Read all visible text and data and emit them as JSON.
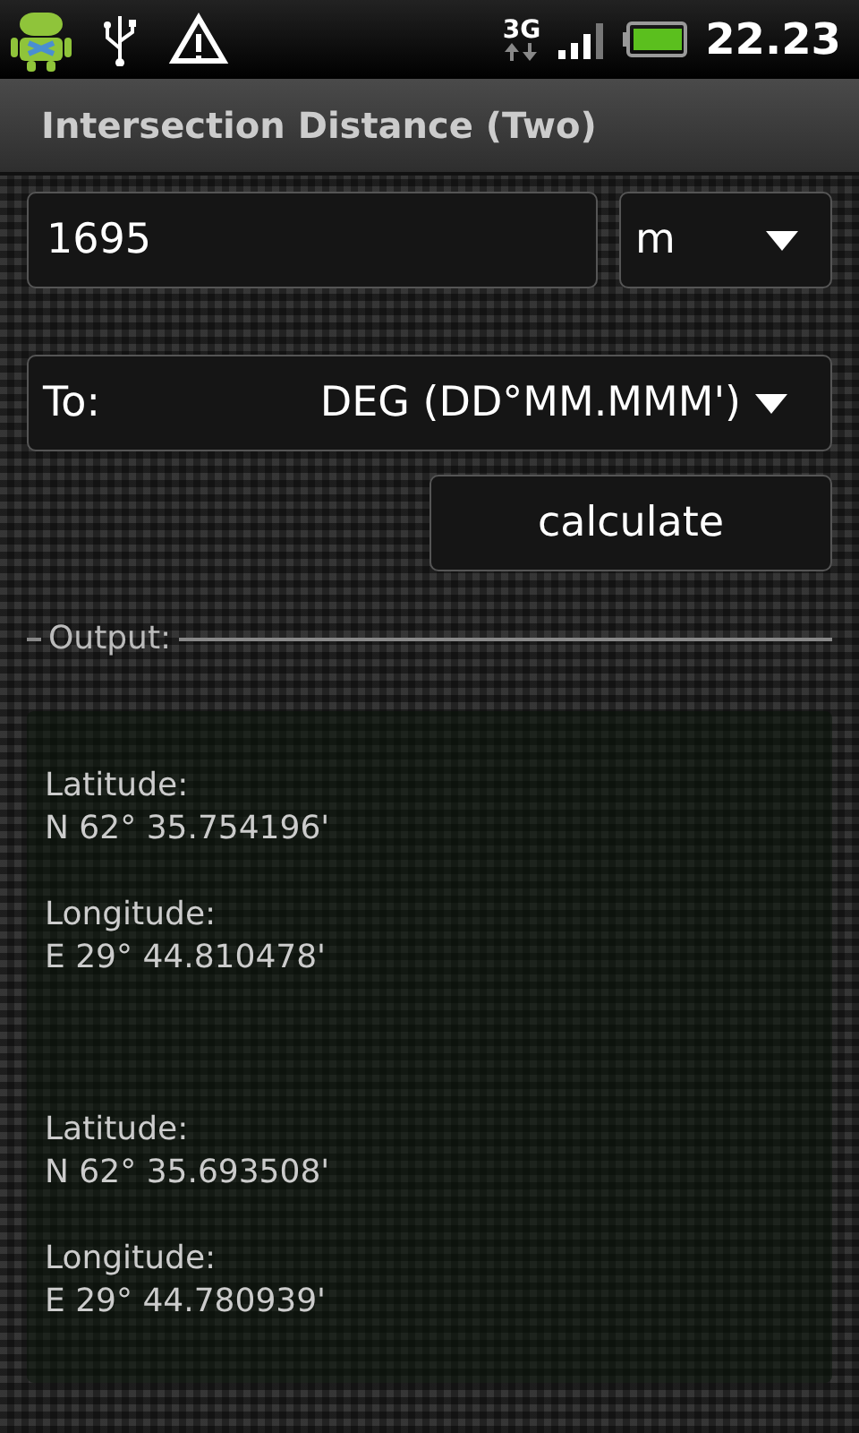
{
  "status_bar": {
    "network": "3G",
    "time": "22.23"
  },
  "window": {
    "title": "Intersection Distance (Two)"
  },
  "distance": {
    "value": "1695",
    "unit": "m"
  },
  "target": {
    "label": "To:",
    "format": "DEG (DD°MM.MMM')"
  },
  "buttons": [
    "calculate"
  ],
  "output": {
    "label": "Output:",
    "points": [
      {
        "latitude_label": "Latitude:",
        "latitude": "N 62° 35.754196'",
        "longitude_label": "Longitude:",
        "longitude": "E 29° 44.810478'"
      },
      {
        "latitude_label": "Latitude:",
        "latitude": "N 62° 35.693508'",
        "longitude_label": "Longitude:",
        "longitude": "E 29° 44.780939'"
      }
    ]
  }
}
